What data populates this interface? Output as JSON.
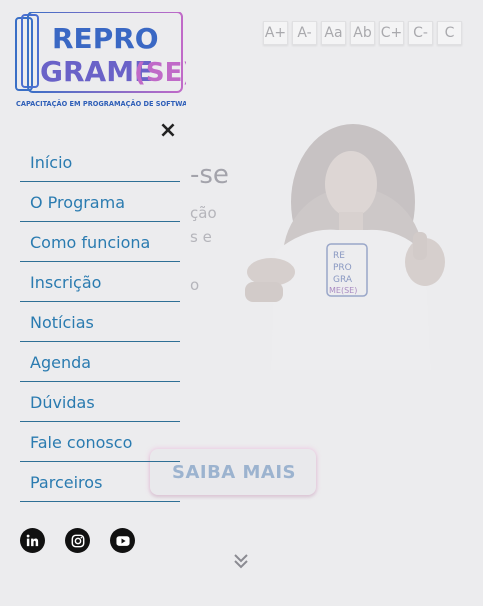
{
  "logo": {
    "line1": "REPRO",
    "line2": "GRAME",
    "suffix": "(SE)",
    "tagline": "CAPACITAÇÃO EM PROGRAMAÇÃO DE SOFTWARE"
  },
  "accessibility": {
    "buttons": [
      "A+",
      "A-",
      "Aa",
      "Ab",
      "C+",
      "C-",
      "C"
    ]
  },
  "hero": {
    "heading_fragment": "-se",
    "lines": [
      "ção",
      "s e",
      "o"
    ],
    "cta_label": "SAIBA MAIS",
    "shirt_text": [
      "RE",
      "PRO",
      "GRA",
      "ME(SE)"
    ]
  },
  "menu": {
    "close_label": "×",
    "items": [
      {
        "label": "Início"
      },
      {
        "label": "O Programa"
      },
      {
        "label": "Como funciona"
      },
      {
        "label": "Inscrição"
      },
      {
        "label": "Notícias"
      },
      {
        "label": "Agenda"
      },
      {
        "label": "Dúvidas"
      },
      {
        "label": "Fale conosco"
      },
      {
        "label": "Parceiros"
      }
    ]
  },
  "socials": [
    {
      "icon": "linkedin-icon"
    },
    {
      "icon": "instagram-icon"
    },
    {
      "icon": "youtube-icon"
    }
  ],
  "colors": {
    "menu_text": "#2a7bb0",
    "menu_divider": "#2e6f95",
    "logo_blue": "#3a6fc6",
    "logo_pink": "#c06ac8"
  }
}
